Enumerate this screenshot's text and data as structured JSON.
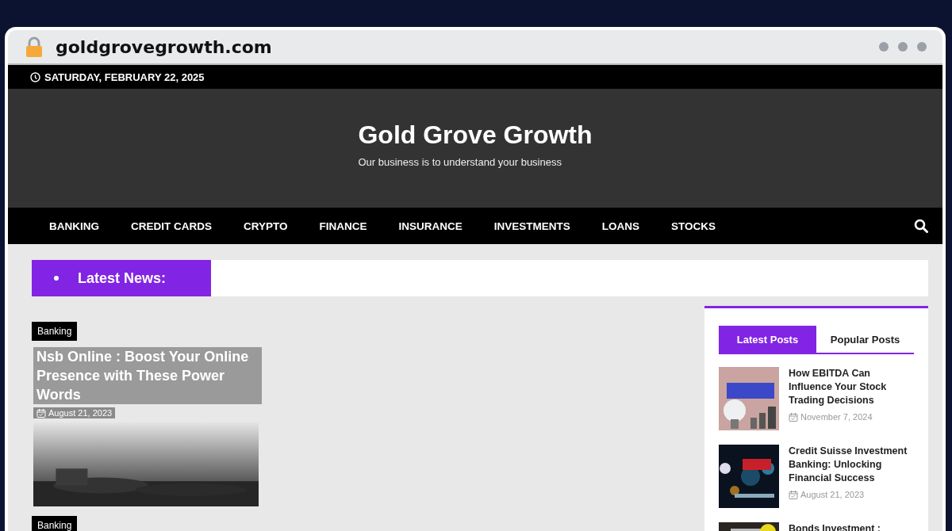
{
  "browser": {
    "url": "goldgrovegrowth.com",
    "secure": true
  },
  "top_bar": {
    "date": "SATURDAY, FEBRUARY 22, 2025"
  },
  "header": {
    "site_title": "Gold Grove Growth",
    "tagline": "Our business is to understand your business"
  },
  "nav": {
    "items": [
      {
        "label": "BANKING"
      },
      {
        "label": "CREDIT CARDS"
      },
      {
        "label": "CRYPTO"
      },
      {
        "label": "FINANCE"
      },
      {
        "label": "INSURANCE"
      },
      {
        "label": "INVESTMENTS"
      },
      {
        "label": "LOANS"
      },
      {
        "label": "STOCKS"
      }
    ]
  },
  "ticker": {
    "label": "Latest News:"
  },
  "articles": [
    {
      "category": "Banking",
      "title": "Nsb Online : Boost Your Online Presence with These Power Words",
      "date": "August 21, 2023",
      "kind": "picture"
    },
    {
      "category": "Banking"
    }
  ],
  "sidebar": {
    "tabs": [
      {
        "label": "Latest Posts",
        "selected": true
      },
      {
        "label": "Popular Posts",
        "selected": false
      }
    ],
    "posts": [
      {
        "title": "How EBITDA Can Influence Your Stock Trading Decisions",
        "date": "November 7, 2024",
        "kind": "bulb"
      },
      {
        "title": "Credit Suisse Investment Banking: Unlocking Financial Success",
        "date": "August 21, 2023",
        "kind": "night"
      },
      {
        "title": "Bonds Investment :",
        "kind": "book"
      }
    ]
  }
}
